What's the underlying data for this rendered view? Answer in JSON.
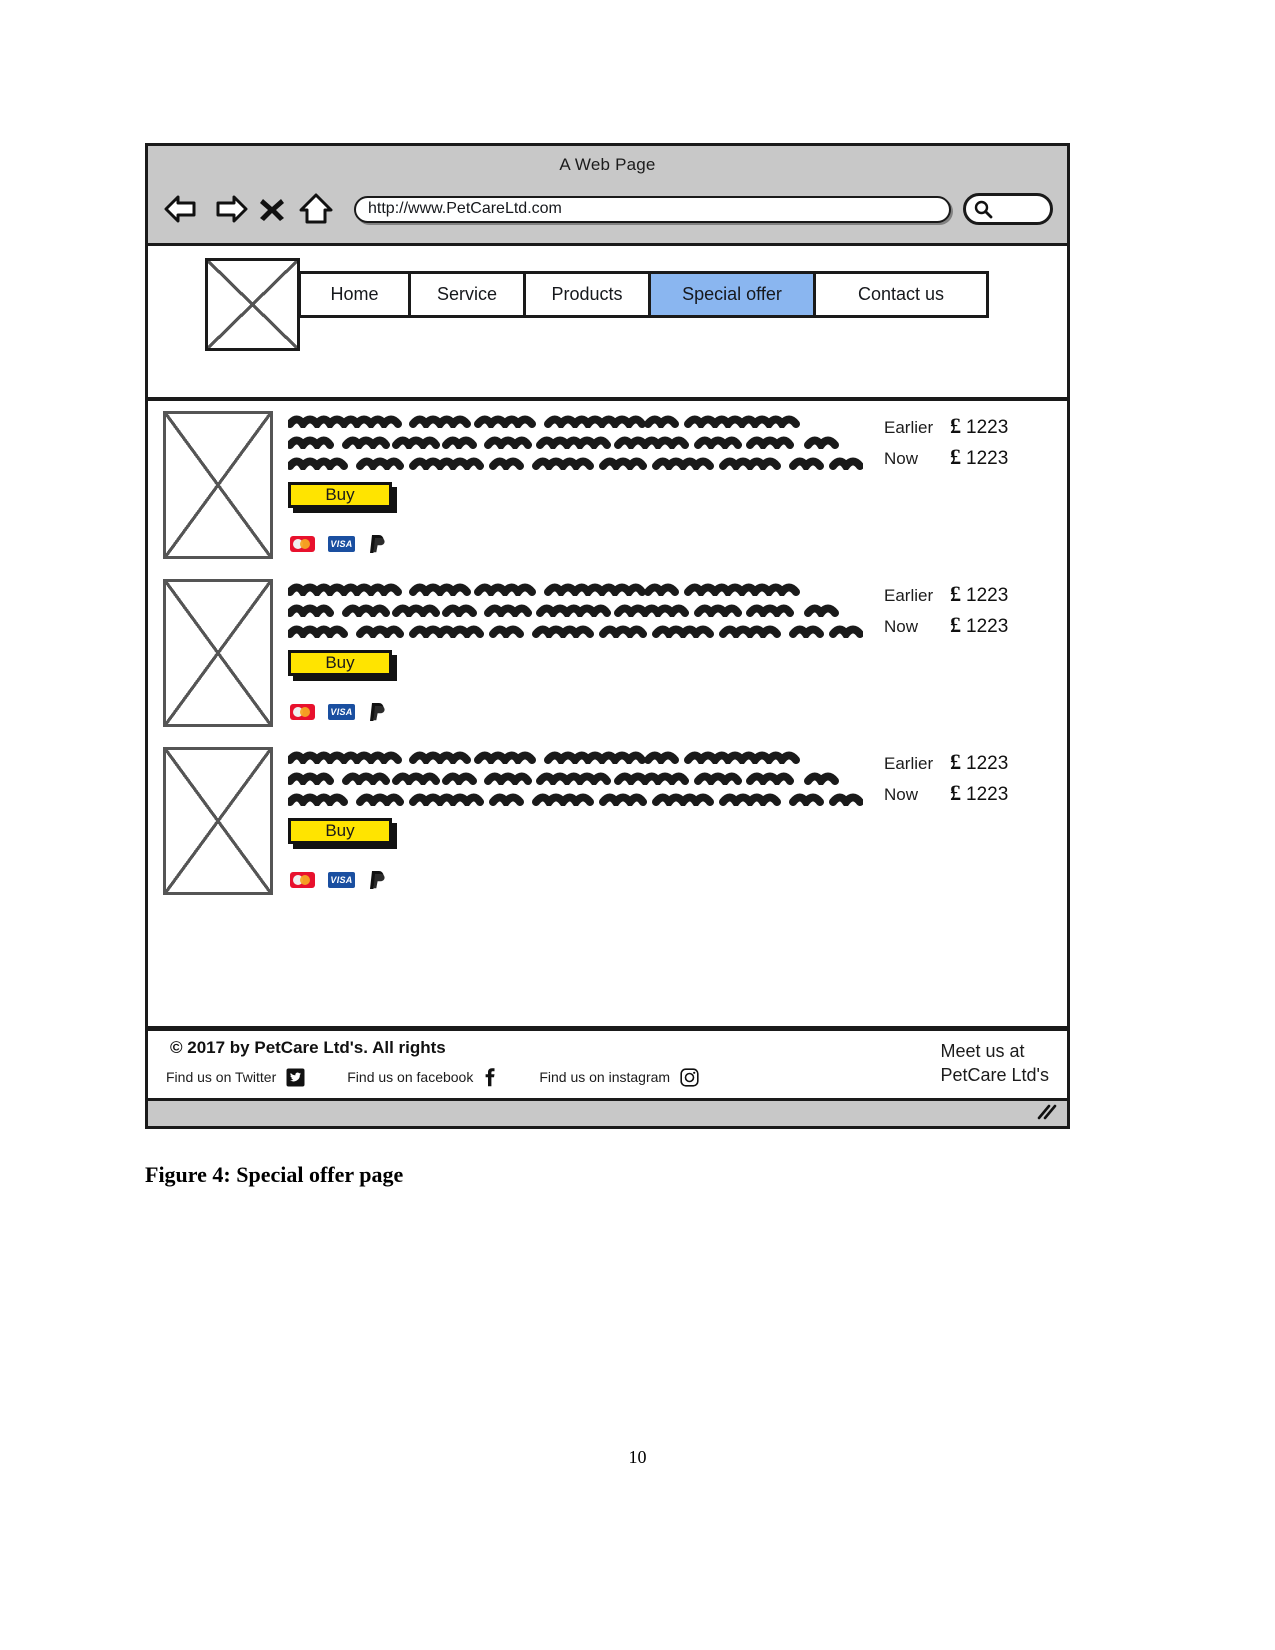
{
  "document": {
    "figure_caption": "Figure 4: Special offer page",
    "page_number": "10"
  },
  "browser": {
    "window_title": "A Web Page",
    "url": "http://www.PetCareLtd.com",
    "controls": [
      {
        "name": "back-icon",
        "label": "Back"
      },
      {
        "name": "forward-icon",
        "label": "Forward"
      },
      {
        "name": "stop-icon",
        "label": "Stop"
      },
      {
        "name": "home-icon",
        "label": "Home"
      }
    ],
    "search_icon": "search-icon"
  },
  "site": {
    "logo_alt": "PetCare Ltd logo placeholder",
    "nav": [
      {
        "label": "Home",
        "active": false
      },
      {
        "label": "Service",
        "active": false
      },
      {
        "label": "Products",
        "active": false
      },
      {
        "label": "Special offer",
        "active": true
      },
      {
        "label": "Contact us",
        "active": false
      }
    ],
    "accent_color": "#8ab6f0",
    "buy_color": "#ffe400"
  },
  "offers": {
    "price_labels": {
      "earlier": "Earlier",
      "now": "Now"
    },
    "currency": "£",
    "buy_label": "Buy",
    "payment_methods": [
      {
        "name": "mastercard-icon",
        "label": "Mastercard"
      },
      {
        "name": "visa-icon",
        "label": "VISA"
      },
      {
        "name": "paypal-icon",
        "label": "PayPal"
      }
    ],
    "items": [
      {
        "image_alt": "Product image placeholder",
        "description_lines": 3,
        "price_earlier": "1223",
        "price_now": "1223"
      },
      {
        "image_alt": "Product image placeholder",
        "description_lines": 3,
        "price_earlier": "1223",
        "price_now": "1223"
      },
      {
        "image_alt": "Product image placeholder",
        "description_lines": 3,
        "price_earlier": "1223",
        "price_now": "1223"
      }
    ]
  },
  "footer": {
    "copyright": "© 2017 by PetCare Ltd's. All rights",
    "social": [
      {
        "label": "Find us on Twitter",
        "icon": "twitter-icon"
      },
      {
        "label": "Find us on facebook",
        "icon": "facebook-icon"
      },
      {
        "label": "Find us on instagram",
        "icon": "instagram-icon"
      }
    ],
    "meet_us_line1": "Meet us at",
    "meet_us_line2": "PetCare Ltd's"
  }
}
